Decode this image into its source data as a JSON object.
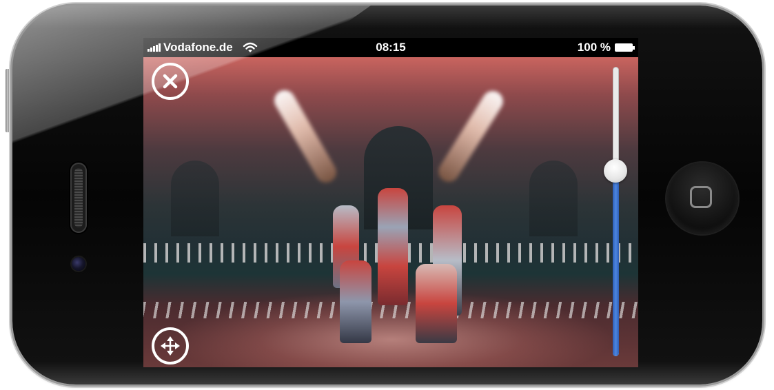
{
  "status_bar": {
    "carrier": "Vodafone.de",
    "time": "08:15",
    "battery_percent": "100 %"
  },
  "player": {
    "volume_level": 0.64
  },
  "icons": {
    "signal": "signal-bars-icon",
    "wifi": "wifi-icon",
    "battery": "battery-icon",
    "close": "close-icon",
    "move": "move-arrows-icon",
    "home": "home-button-icon"
  },
  "colors": {
    "slider_fill": "#3f76d6",
    "slider_track": "#eaeaea",
    "overlay_icon": "#ffffff",
    "status_bar_bg": "#000000"
  }
}
